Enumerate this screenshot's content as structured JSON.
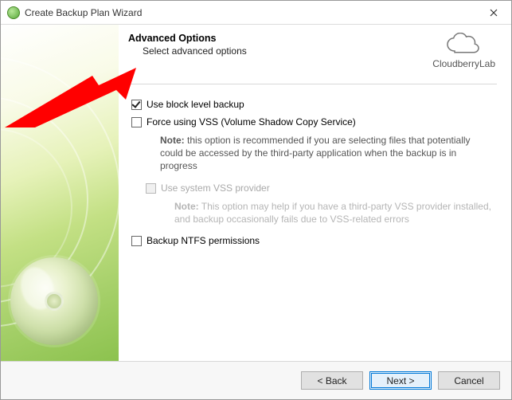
{
  "window": {
    "title": "Create Backup Plan Wizard"
  },
  "header": {
    "heading": "Advanced Options",
    "subheading": "Select advanced options"
  },
  "brand": {
    "name": "CloudberryLab"
  },
  "options": {
    "block_level": {
      "label": "Use block level backup",
      "checked": true
    },
    "force_vss": {
      "label": "Force using VSS (Volume Shadow Copy Service)",
      "checked": false,
      "note_label": "Note:",
      "note_text": "this option is recommended if you are selecting files that potentially could be accessed by the third-party application when the backup is in progress"
    },
    "system_vss": {
      "label": "Use system VSS provider",
      "checked": false,
      "disabled": true,
      "note_label": "Note:",
      "note_text": "This option may help if you have a third-party VSS provider installed, and backup occasionally fails due to VSS-related errors"
    },
    "ntfs_perms": {
      "label": "Backup NTFS permissions",
      "checked": false
    }
  },
  "buttons": {
    "back": "< Back",
    "next": "Next >",
    "cancel": "Cancel"
  }
}
